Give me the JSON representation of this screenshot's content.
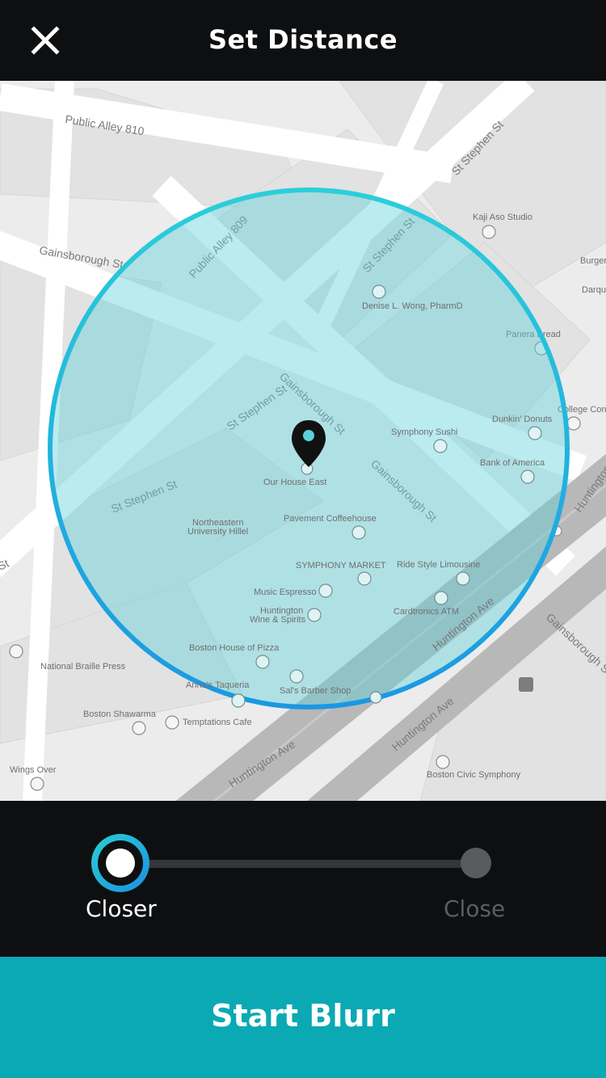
{
  "header": {
    "title": "Set Distance",
    "close_icon": "close-icon"
  },
  "map": {
    "streets": {
      "public_alley_810": "Public Alley 810",
      "public_alley_809": "Public Alley 809",
      "st_stephen_st_1": "St Stephen St",
      "st_stephen_st_2": "St Stephen St",
      "st_stephen_st_3": "St Stephen St",
      "st_stephen_st_4": "St Stephen St",
      "gainsborough_st_1": "Gainsborough St",
      "gainsborough_st_2": "Gainsborough St",
      "gainsborough_st_3": "Gainsborough St",
      "gainsborough_st_4": "Gainsborough St",
      "gainsborough_st_5": "Gainsborough St",
      "huntington_ave_1": "Huntington Ave",
      "huntington_ave_2": "Huntington Ave",
      "huntington_ave_3": "Huntington Ave",
      "huntington_ave_4": "Huntington",
      "st_fragment": "St"
    },
    "places": {
      "kaji_aso": "Kaji Aso Studio",
      "burger": "Burger",
      "darqu": "Darqu",
      "denise": "Denise L. Wong, PharmD",
      "panera": "Panera Bread",
      "college": "College Conv",
      "dunkin": "Dunkin' Donuts",
      "symphony_sushi": "Symphony Sushi",
      "bank_of_america": "Bank of America",
      "our_house_east": "Our House East",
      "northeastern_1": "Northeastern",
      "northeastern_2": "University Hillel",
      "pavement": "Pavement Coffeehouse",
      "symphony_market": "SYMPHONY MARKET",
      "ride_style": "Ride Style Limousine",
      "music_espresso": "Music Espresso",
      "huntington_wine_1": "Huntington",
      "huntington_wine_2": "Wine & Spirits",
      "cardtronics": "Cardtronics ATM",
      "boston_house_pizza": "Boston House of Pizza",
      "national_braille": "National Braille Press",
      "anna_taqueria": "Anna's Taqueria",
      "sals_barber": "Sal's Barber Shop",
      "boston_shawarma": "Boston Shawarma",
      "temptations": "Temptations Cafe",
      "wings_over": "Wings Over",
      "boston_civic": "Boston Civic Symphony"
    },
    "pin_icon": "map-pin-icon",
    "radius_color": "#2bcfd9"
  },
  "slider": {
    "selected_index": 0,
    "options": [
      "Closer",
      "Close"
    ],
    "accent_color": "#28d0d6"
  },
  "cta": {
    "label": "Start Blurr",
    "color": "#0aa9b4"
  }
}
